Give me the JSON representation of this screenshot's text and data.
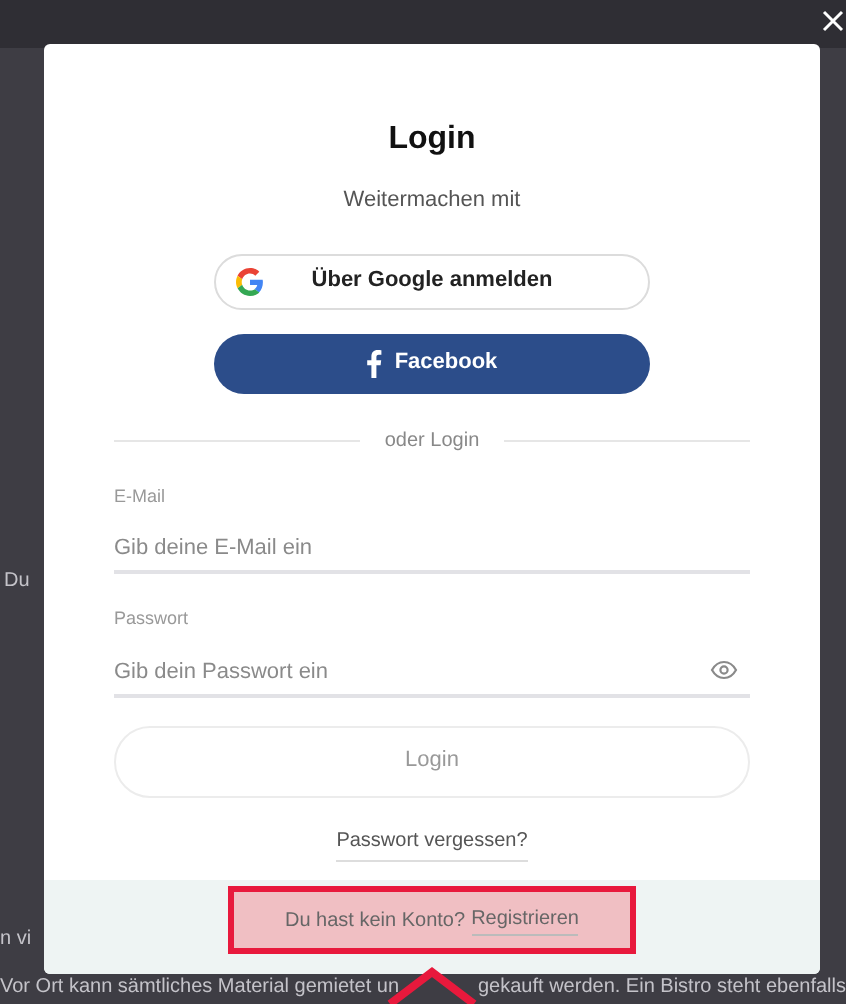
{
  "background": {
    "texts": [
      {
        "kind": "side",
        "text": "Du"
      },
      {
        "kind": "side2",
        "text": "n vi"
      },
      {
        "kind": "line",
        "text": "Vor Ort kann sämtliches Material gemietet un"
      },
      {
        "kind": "line2",
        "text": "gekauft werden. Ein Bistro steht ebenfalls"
      }
    ]
  },
  "dialog": {
    "title": "Login",
    "subtitle": "Weitermachen mit",
    "social_buttons": [
      {
        "kind": "google",
        "label": "Über Google anmelden"
      },
      {
        "kind": "facebook",
        "label": "Facebook"
      }
    ],
    "divider": "oder Login",
    "fields": [
      {
        "kind": "text",
        "label": "E-Mail",
        "placeholder": "Gib deine E-Mail ein"
      },
      {
        "kind": "password",
        "label": "Passwort",
        "placeholder": "Gib dein Passwort ein"
      }
    ],
    "login_button": {
      "label": "Login",
      "disabled": true
    },
    "forgot_link": "Passwort vergessen?",
    "register": {
      "prompt": "Du hast kein Konto?",
      "link": "Registrieren"
    }
  }
}
